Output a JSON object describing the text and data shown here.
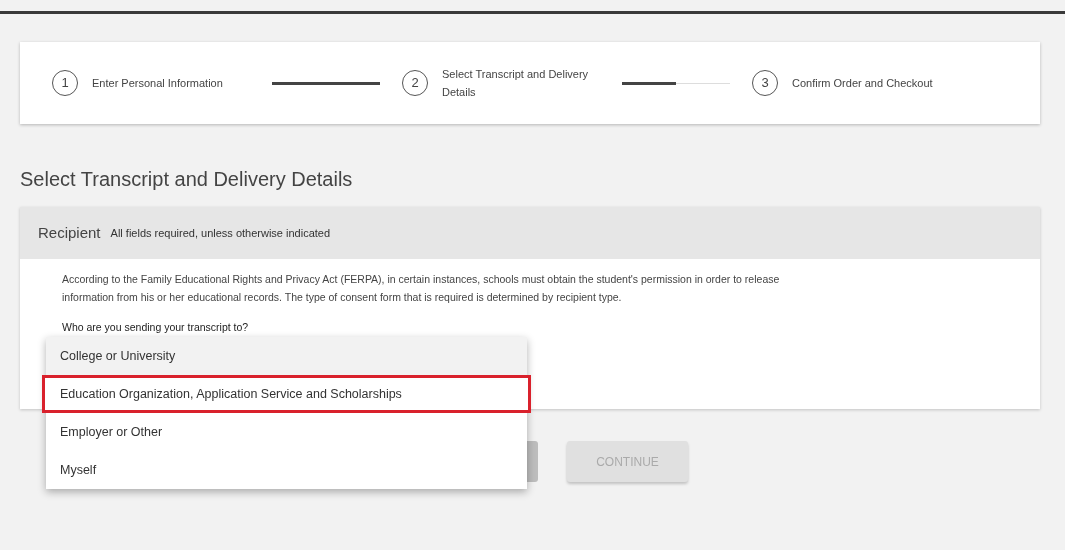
{
  "steps": [
    {
      "number": "1",
      "label": "Enter Personal Information"
    },
    {
      "number": "2",
      "label": "Select Transcript and Delivery Details"
    },
    {
      "number": "3",
      "label": "Confirm Order and Checkout"
    }
  ],
  "connectors": [
    {
      "level": 1
    },
    {
      "level": 0.5
    }
  ],
  "heading": "Select Transcript and Delivery Details",
  "panel": {
    "title": "Recipient",
    "note": "All fields required, unless otherwise indicated",
    "body": "According to the Family Educational Rights and Privacy Act (FERPA), in certain instances, schools must obtain the student's permission in order to release information from his or her educational records. The type of consent form that is required is determined by recipient type.",
    "field_label": "Who are you sending your transcript to?"
  },
  "menu": {
    "items": [
      {
        "label": "College or University",
        "hovered": true,
        "outlined": false
      },
      {
        "label": "Education Organization, Application Service and Scholarships",
        "hovered": false,
        "outlined": true
      },
      {
        "label": "Employer or Other",
        "hovered": false,
        "outlined": false
      },
      {
        "label": "Myself",
        "hovered": false,
        "outlined": false
      }
    ]
  },
  "continue_button": {
    "label": "CONTINUE",
    "disabled": true
  }
}
